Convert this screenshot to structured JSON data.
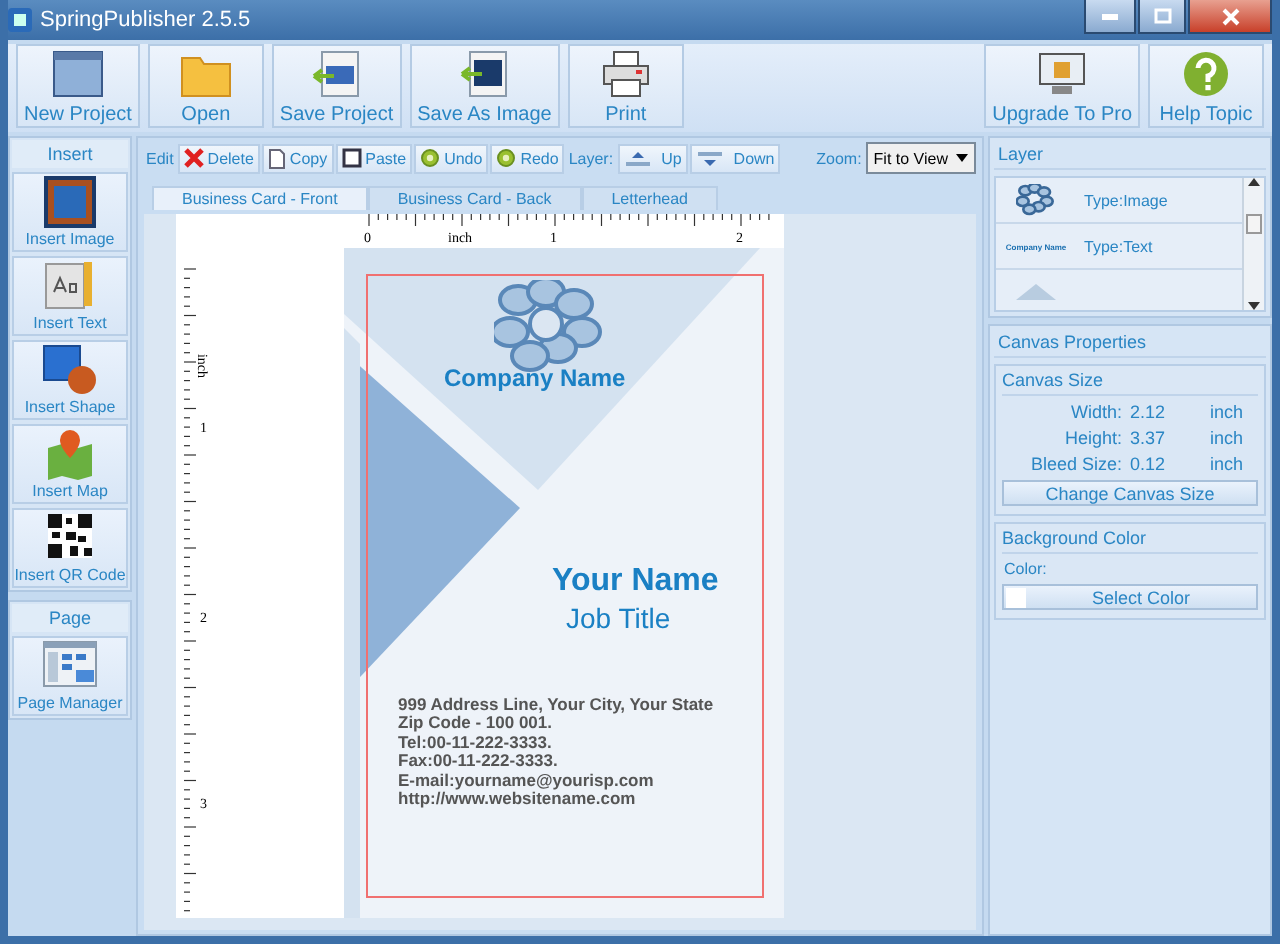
{
  "window": {
    "title": "SpringPublisher 2.5.5"
  },
  "toolbar": {
    "left": [
      {
        "label": "New Project"
      },
      {
        "label": "Open"
      },
      {
        "label": "Save Project"
      },
      {
        "label": "Save As Image"
      },
      {
        "label": "Print"
      }
    ],
    "right": [
      {
        "label": "Upgrade To Pro"
      },
      {
        "label": "Help Topic"
      }
    ]
  },
  "insert_panel": {
    "title": "Insert",
    "items": [
      {
        "label": "Insert Image"
      },
      {
        "label": "Insert Text"
      },
      {
        "label": "Insert Shape"
      },
      {
        "label": "Insert Map"
      },
      {
        "label": "Insert QR Code"
      }
    ]
  },
  "page_panel": {
    "title": "Page",
    "items": [
      {
        "label": "Page Manager"
      }
    ]
  },
  "edit_bar": {
    "edit_label": "Edit",
    "buttons": [
      {
        "label": "Delete"
      },
      {
        "label": "Copy"
      },
      {
        "label": "Paste"
      },
      {
        "label": "Undo"
      },
      {
        "label": "Redo"
      }
    ],
    "layer_label": "Layer:",
    "layer_buttons": [
      {
        "label": "Up"
      },
      {
        "label": "Down"
      }
    ],
    "zoom_label": "Zoom:",
    "zoom_value": "Fit to View"
  },
  "tabs": [
    {
      "label": "Business Card - Front",
      "selected": true
    },
    {
      "label": "Business Card - Back",
      "selected": false
    },
    {
      "label": "Letterhead",
      "selected": false
    }
  ],
  "ruler": {
    "unit": "inch",
    "marks": [
      "0",
      "1",
      "2"
    ]
  },
  "vertical_ruler": {
    "unit": "inch",
    "marks": [
      "1",
      "2",
      "3"
    ]
  },
  "card": {
    "company": "Company Name",
    "name": "Your Name",
    "job_title": "Job Title",
    "details": [
      "999 Address Line, Your City, Your State",
      "Zip Code - 100 001.",
      "Tel:00-11-222-3333.",
      "Fax:00-11-222-3333.",
      "E-mail:yourname@yourisp.com",
      "http://www.websitename.com"
    ]
  },
  "layer_panel": {
    "title": "Layer",
    "items": [
      {
        "kind": "image",
        "type": "Type:Image"
      },
      {
        "kind": "text",
        "preview": "Company Name",
        "type": "Type:Text"
      },
      {
        "kind": "shape"
      }
    ]
  },
  "canvas_properties": {
    "title": "Canvas Properties",
    "size_group": {
      "title": "Canvas Size",
      "rows": [
        {
          "label": "Width:",
          "value": "2.12",
          "unit": "inch"
        },
        {
          "label": "Height:",
          "value": "3.37",
          "unit": "inch"
        },
        {
          "label": "Bleed Size:",
          "value": "0.12",
          "unit": "inch"
        }
      ],
      "button": "Change Canvas Size"
    },
    "background_group": {
      "title": "Background Color",
      "label": "Color:",
      "button": "Select Color"
    }
  }
}
